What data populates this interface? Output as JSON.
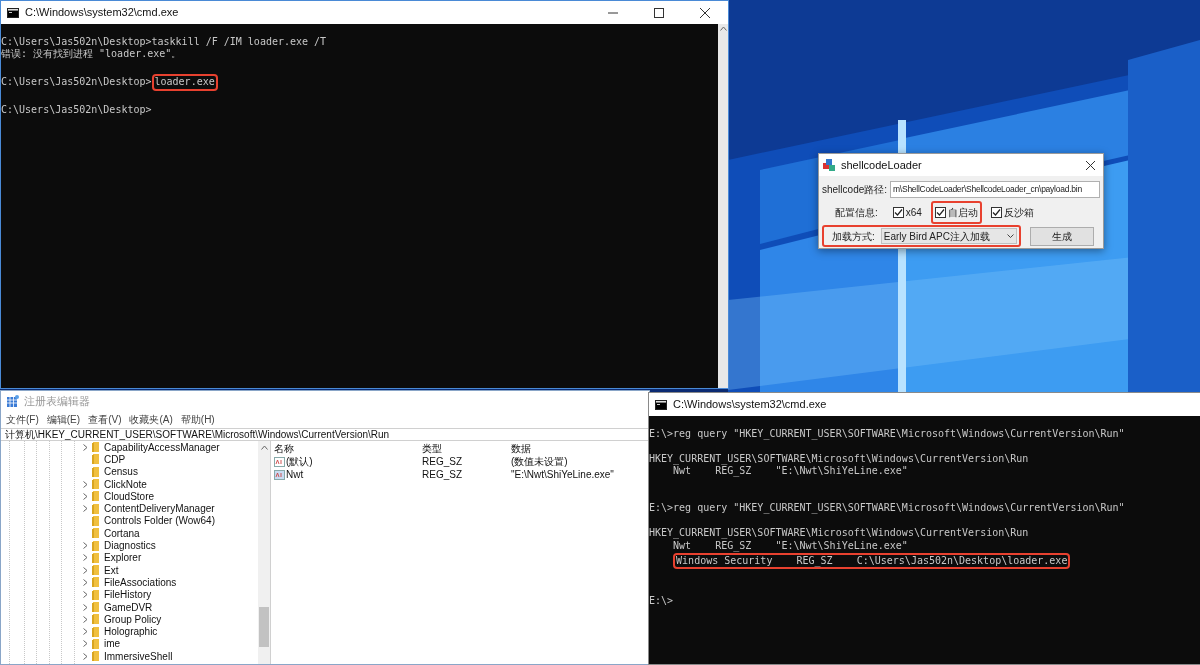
{
  "console_top": {
    "title": "C:\\Windows\\system32\\cmd.exe",
    "lines": [
      {
        "kind": "text",
        "indented": false,
        "segments": [
          {
            "text": "C:\\Users\\Jas502n\\Desktop>taskkill /F /IM loader.exe /T",
            "highlighted": false
          }
        ]
      },
      {
        "kind": "text",
        "indented": false,
        "segments": [
          {
            "text": "错误: 没有找到进程 \"loader.exe\"。",
            "highlighted": false
          }
        ]
      },
      {
        "kind": "blank"
      },
      {
        "kind": "text",
        "indented": false,
        "segments": [
          {
            "text": "C:\\Users\\Jas502n\\Desktop>",
            "highlighted": false
          },
          {
            "text": "loader.exe",
            "highlighted": true
          }
        ]
      },
      {
        "kind": "blank"
      },
      {
        "kind": "text",
        "indented": false,
        "segments": [
          {
            "text": "C:\\Users\\Jas502n\\Desktop>",
            "highlighted": false
          }
        ]
      }
    ]
  },
  "shellcode_loader": {
    "title": "shellcodeLoader",
    "path_label": "shellcode路径:",
    "path_value": "m\\ShellCodeLoader\\ShellcodeLoader_cn\\payload.bin",
    "config_label": "配置信息:",
    "options": [
      {
        "label": "x64",
        "checked": true,
        "highlighted": false
      },
      {
        "label": "自启动",
        "checked": true,
        "highlighted": true
      },
      {
        "label": "反沙箱",
        "checked": true,
        "highlighted": false
      }
    ],
    "load_label": "加载方式:",
    "load_value": "Early Bird APC注入加载",
    "load_highlighted": true,
    "generate_button": "生成"
  },
  "registry_editor": {
    "title": "注册表编辑器",
    "menu": [
      "文件(F)",
      "编辑(E)",
      "查看(V)",
      "收藏夹(A)",
      "帮助(H)"
    ],
    "address": "计算机\\HKEY_CURRENT_USER\\SOFTWARE\\Microsoft\\Windows\\CurrentVersion\\Run",
    "tree": [
      {
        "label": "CapabilityAccessManager",
        "expandable": true
      },
      {
        "label": "CDP",
        "expandable": false
      },
      {
        "label": "Census",
        "expandable": false
      },
      {
        "label": "ClickNote",
        "expandable": true
      },
      {
        "label": "CloudStore",
        "expandable": true
      },
      {
        "label": "ContentDeliveryManager",
        "expandable": true
      },
      {
        "label": "Controls Folder (Wow64)",
        "expandable": false
      },
      {
        "label": "Cortana",
        "expandable": false
      },
      {
        "label": "Diagnostics",
        "expandable": true
      },
      {
        "label": "Explorer",
        "expandable": true
      },
      {
        "label": "Ext",
        "expandable": true
      },
      {
        "label": "FileAssociations",
        "expandable": true
      },
      {
        "label": "FileHistory",
        "expandable": true
      },
      {
        "label": "GameDVR",
        "expandable": true
      },
      {
        "label": "Group Policy",
        "expandable": true
      },
      {
        "label": "Holographic",
        "expandable": true
      },
      {
        "label": "ime",
        "expandable": true
      },
      {
        "label": "ImmersiveShell",
        "expandable": true
      }
    ],
    "columns": [
      "名称",
      "类型",
      "数据"
    ],
    "rows": [
      {
        "name": "(默认)",
        "type": "REG_SZ",
        "data": "(数值未设置)"
      },
      {
        "name": "Nwt",
        "type": "REG_SZ",
        "data": "\"E:\\Nwt\\ShiYeLine.exe\""
      }
    ]
  },
  "console_bottom": {
    "title": "C:\\Windows\\system32\\cmd.exe",
    "lines": [
      {
        "kind": "text",
        "indented": false,
        "segments": [
          {
            "text": "E:\\>reg query \"HKEY_CURRENT_USER\\SOFTWARE\\Microsoft\\Windows\\CurrentVersion\\Run\"",
            "highlighted": false
          }
        ]
      },
      {
        "kind": "blank"
      },
      {
        "kind": "text",
        "indented": false,
        "segments": [
          {
            "text": "HKEY_CURRENT_USER\\SOFTWARE\\Microsoft\\Windows\\CurrentVersion\\Run",
            "highlighted": false
          }
        ]
      },
      {
        "kind": "text",
        "indented": true,
        "segments": [
          {
            "text": "Nwt    REG_SZ    \"E:\\Nwt\\ShiYeLine.exe\"",
            "highlighted": false
          }
        ]
      },
      {
        "kind": "blank"
      },
      {
        "kind": "blank"
      },
      {
        "kind": "text",
        "indented": false,
        "segments": [
          {
            "text": "E:\\>reg query \"HKEY_CURRENT_USER\\SOFTWARE\\Microsoft\\Windows\\CurrentVersion\\Run\"",
            "highlighted": false
          }
        ]
      },
      {
        "kind": "blank"
      },
      {
        "kind": "text",
        "indented": false,
        "segments": [
          {
            "text": "HKEY_CURRENT_USER\\SOFTWARE\\Microsoft\\Windows\\CurrentVersion\\Run",
            "highlighted": false
          }
        ]
      },
      {
        "kind": "text",
        "indented": true,
        "segments": [
          {
            "text": "Nwt    REG_SZ    \"E:\\Nwt\\ShiYeLine.exe\"",
            "highlighted": false
          }
        ]
      },
      {
        "kind": "text",
        "indented": true,
        "segments": [
          {
            "text": "Windows Security    REG_SZ    C:\\Users\\Jas502n\\Desktop\\loader.exe",
            "highlighted": true
          }
        ]
      },
      {
        "kind": "blank"
      },
      {
        "kind": "blank"
      },
      {
        "kind": "text",
        "indented": false,
        "segments": [
          {
            "text": "E:\\>",
            "highlighted": false
          }
        ]
      }
    ]
  }
}
